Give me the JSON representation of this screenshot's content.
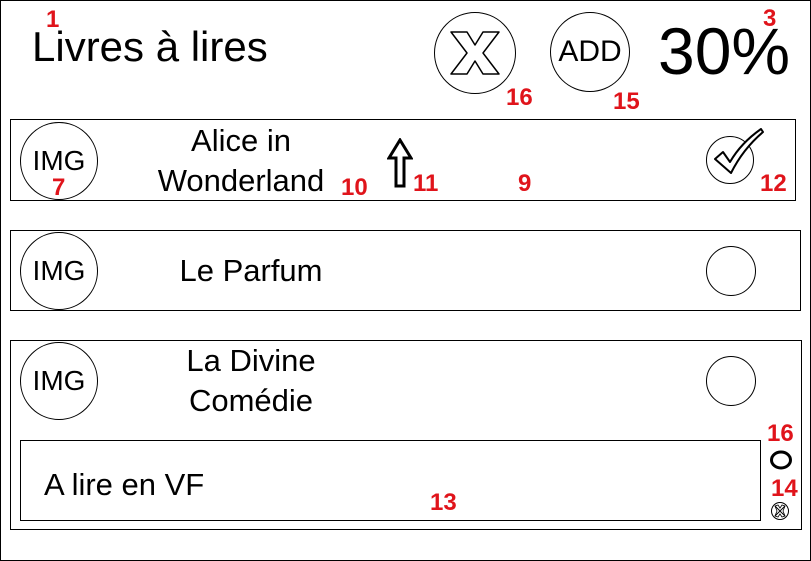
{
  "header": {
    "title": "Livres à lires",
    "progress_text": "30%",
    "add_label": "ADD"
  },
  "books": [
    {
      "img_label": "IMG",
      "title": "Alice in\nWonderland",
      "checked": true
    },
    {
      "img_label": "IMG",
      "title": "Le Parfum",
      "checked": false
    },
    {
      "img_label": "IMG",
      "title": "La Divine\nComédie",
      "checked": false
    }
  ],
  "note": {
    "text": "A lire en VF"
  },
  "annotations": {
    "a1": "1",
    "a3": "3",
    "a16_top": "16",
    "a15": "15",
    "a7": "7",
    "a10": "10",
    "a11": "11",
    "a9": "9",
    "a12": "12",
    "a16_side": "16",
    "a14": "14",
    "a13": "13"
  },
  "colors": {
    "annotation": "#e0141b",
    "ink": "#000000",
    "background": "#ffffff"
  },
  "icons": {
    "delete": "x-icon",
    "reorder": "up-arrow-icon",
    "done": "checkmark-icon",
    "small_toggle": "small-ring-icon",
    "small_delete": "small-x-icon"
  }
}
